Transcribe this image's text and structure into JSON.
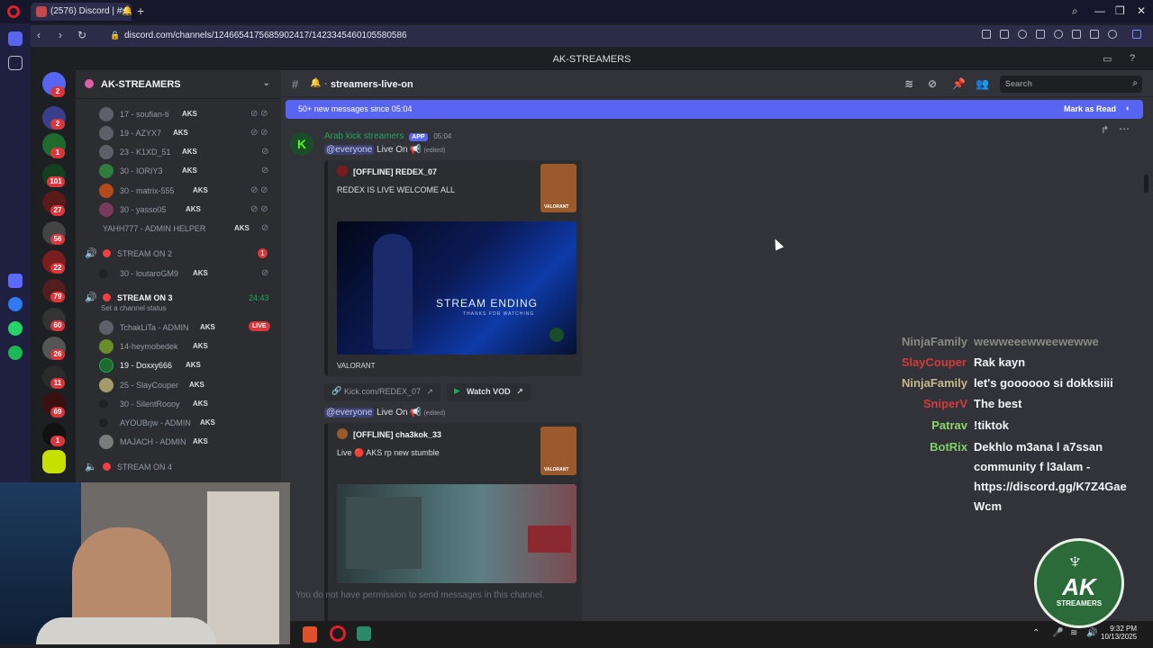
{
  "browser": {
    "tab_title": "(2576) Discord | #🔔",
    "url": "discord.com/channels/1246654175685902417/1423345460105580586",
    "new_tab_label": "+",
    "back_label": "‹",
    "forward_label": "›",
    "reload_label": "↻"
  },
  "discord": {
    "window_title": "AK-STREAMERS",
    "guild_name": "AK-STREAMERS",
    "servers": [
      {
        "badge": "2"
      },
      {
        "badge": "2"
      },
      {
        "badge": "1"
      },
      {
        "badge": "101"
      },
      {
        "badge": "27"
      },
      {
        "badge": "56"
      },
      {
        "badge": "22"
      },
      {
        "badge": "79"
      },
      {
        "badge": "60"
      },
      {
        "badge": "26"
      },
      {
        "badge": "11"
      },
      {
        "badge": "69"
      },
      {
        "badge": "1"
      }
    ],
    "voice_members_top": [
      {
        "name": "17 - soufian-ti",
        "tag": "AKS"
      },
      {
        "name": "19 - AZYX7",
        "tag": "AKS"
      },
      {
        "name": "23 - K1XD_51",
        "tag": "AKS"
      },
      {
        "name": "30 - IORIY3",
        "tag": "AKS"
      },
      {
        "name": "30 - matrix-555",
        "tag": "AKS"
      },
      {
        "name": "30 - yasso05",
        "tag": "AKS"
      },
      {
        "name": "YAHH777 - ADMIN HELPER",
        "tag": "AKS"
      }
    ],
    "stream_on_2": {
      "label": "STREAM ON 2",
      "badge": "1"
    },
    "stream_on_2_member": {
      "name": "30 - loutaroGM9",
      "tag": "AKS"
    },
    "stream_on_3": {
      "label": "STREAM ON 3",
      "timer": "24:43",
      "status_hint": "Set a channel status"
    },
    "voice_members_3": [
      {
        "name": "TchakLiTa - ADMIN",
        "tag": "AKS"
      },
      {
        "name": "14-heymobedek",
        "tag": "AKS"
      },
      {
        "name": "19 - Doxxy666",
        "tag": "AKS"
      },
      {
        "name": "25 - SlayCouper",
        "tag": "AKS"
      },
      {
        "name": "30 - SilentRoooy",
        "tag": "AKS"
      },
      {
        "name": "AYOUBrjw - ADMIN",
        "tag": "AKS"
      },
      {
        "name": "MAJACH - ADMIN",
        "tag": "AKS"
      }
    ],
    "live_badge": "LIVE",
    "stream_on_4": {
      "label": "STREAM ON 4"
    },
    "channel_name": "streamers-live-on",
    "search_placeholder": "Search",
    "new_messages_bar": "50+ new messages since 05:04",
    "mark_as_read": "Mark as Read",
    "message": {
      "author": "Arab kick streamers",
      "app_tag": "APP",
      "time": "05:04",
      "mention": "@everyone",
      "live_text": "Live On",
      "edited": "(edited)"
    },
    "embed1": {
      "title": "[OFFLINE] REDEX_07",
      "desc": "REDEX IS LIVE WELCOME ALL",
      "image_title": "STREAM ENDING",
      "image_subtitle": "THANKS FOR WATCHING",
      "footer": "VALORANT",
      "thumb_label": "VALORANT"
    },
    "link_button": "Kick.com/REDEX_07",
    "vod_button": "Watch VOD",
    "embed2": {
      "title": "[OFFLINE] cha3kok_33",
      "desc": "Live 🔴 AKS rp new stumble",
      "thumb_label": "VALORANT"
    },
    "no_permission": "You do not have permission to send messages in this channel."
  },
  "chat_overlay": [
    {
      "user": "NinjaFamily",
      "text": "wewweeewweewewwe",
      "color": "#8b8a84"
    },
    {
      "user": "SlayCouper",
      "text": "Rak kayn",
      "color": "#d33b3b"
    },
    {
      "user": "NinjaFamily",
      "text": "let's goooooo si dokksiiii",
      "color": "#c8b98a"
    },
    {
      "user": "SniperV",
      "text": "The best",
      "color": "#d33b3b"
    },
    {
      "user": "Patrav",
      "text": "!tiktok",
      "color": "#8fd46b"
    },
    {
      "user": "BotRix",
      "text": "Dekhlo m3ana l a7ssan",
      "color": "#7cd16a"
    }
  ],
  "chat_overlay_cont": [
    "community f l3alam -",
    "https://discord.gg/K7Z4Gae",
    "Wcm"
  ],
  "brand": {
    "name": "AK",
    "sub": "STREAMERS"
  },
  "taskbar": {
    "time": "9:32 PM",
    "date": "10/13/2025"
  },
  "colors": {
    "accent": "#5865f2",
    "danger": "#da373c",
    "online": "#23a559"
  }
}
